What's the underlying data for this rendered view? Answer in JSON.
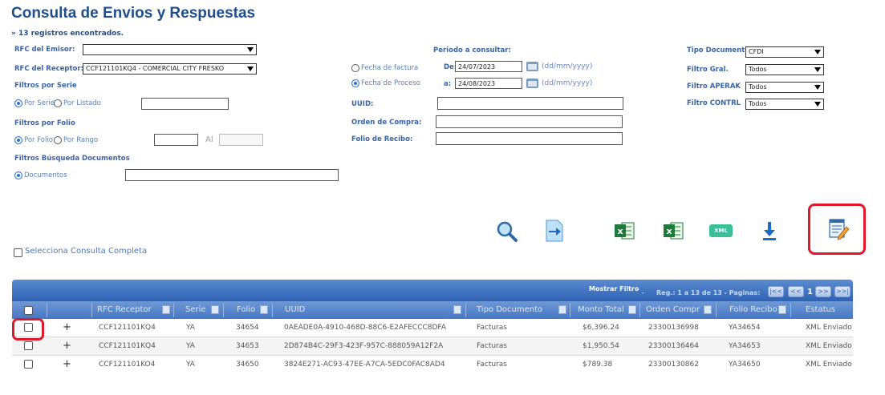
{
  "page": {
    "title": "Consulta de Envios y Respuestas",
    "records_found": "» 13 registros encontrados."
  },
  "filters": {
    "rfc_emisor_label": "RFC del Emisor:",
    "rfc_emisor_value": "",
    "rfc_receptor_label": "RFC del Receptor:",
    "rfc_receptor_value": "CCF121101KQ4 - COMERCIAL CITY FRESKO",
    "serie_section": "Filtros por Serie",
    "por_serie": "Por Serie",
    "por_listado": "Por Listado",
    "folio_section": "Filtros por Folio",
    "por_folio": "Por Folio",
    "por_rango": "Por Rango",
    "al_label": "Al",
    "docs_section": "Filtros Búsqueda Documentos",
    "documentos": "Documentos",
    "fecha_factura": "Fecha de factura",
    "fecha_proceso": "Fecha de Proceso",
    "periodo_label": "Periodo a consultar:",
    "de_label": "De:",
    "de_value": "24/07/2023",
    "a_label": "a:",
    "a_value": "24/08/2023",
    "date_hint": "(dd/mm/yyyy)",
    "uuid_label": "UUID:",
    "orden_label": "Orden de Compra:",
    "folio_recibo_label": "Folio de Recibo:",
    "tipo_doc_label": "Tipo Documento",
    "tipo_doc_value": "CFDI",
    "filtro_gral_label": "Filtro Gral.",
    "filtro_gral_value": "Todos",
    "filtro_aperak_label": "Filtro APERAK",
    "filtro_aperak_value": "Todos",
    "filtro_contrl_label": "Filtro CONTRL",
    "filtro_contrl_value": "Todos"
  },
  "toolbar": {
    "xml_badge": "XML"
  },
  "select_all_label": "Selecciona Consulta Completa",
  "grid": {
    "mostrar_filtro": "Mostrar Filtro",
    "records_info": "Reg.: 1 a 13 de 13 - Paginas:",
    "page_current": "1",
    "first": "|<<",
    "prev": "<<",
    "next": ">>",
    "last": ">>|",
    "columns": {
      "rfc": "RFC Receptor",
      "serie": "Serie",
      "folio": "Folio",
      "uuid": "UUID",
      "tipo": "Tipo Documento",
      "monto": "Monto Total",
      "orden": "Orden Compr",
      "folio_recibo": "Folio Recibo",
      "estatus": "Estatus"
    },
    "rows": [
      {
        "expand": "+",
        "rfc": "CCF121101KQ4",
        "serie": "YA",
        "folio": "34654",
        "uuid": "0AEADE0A-4910-468D-88C6-E2AFECCC8DFA",
        "tipo": "Facturas",
        "monto": "$6,396.24",
        "orden": "23300136998",
        "folio_recibo": "YA34654",
        "estatus": "XML Enviado"
      },
      {
        "expand": "+",
        "rfc": "CCF121101KQ4",
        "serie": "YA",
        "folio": "34653",
        "uuid": "2D874B4C-29F3-423F-957C-888059A12F2A",
        "tipo": "Facturas",
        "monto": "$1,950.54",
        "orden": "23300136464",
        "folio_recibo": "YA34653",
        "estatus": "XML Enviado"
      },
      {
        "expand": "+",
        "rfc": "CCF121101KO4",
        "serie": "YA",
        "folio": "34650",
        "uuid": "3824E271-AC93-47EE-A7CA-5EDC0FAC8AD4",
        "tipo": "Facturas",
        "monto": "$789.38",
        "orden": "23300130862",
        "folio_recibo": "YA34650",
        "estatus": "XML Enviado"
      }
    ]
  }
}
